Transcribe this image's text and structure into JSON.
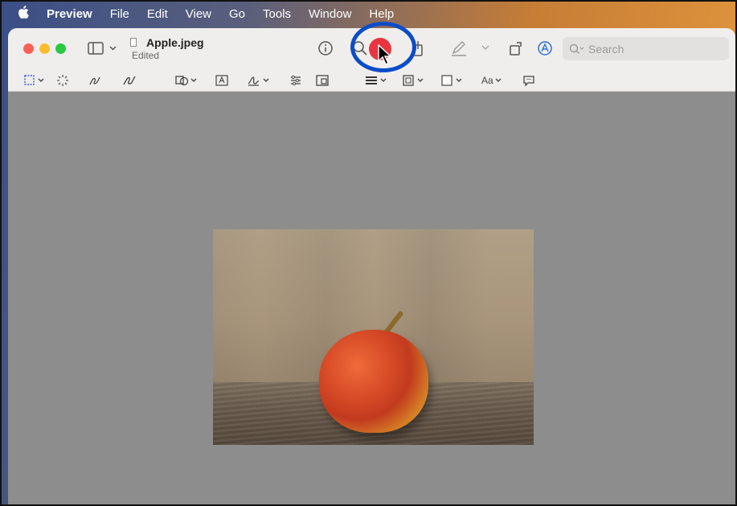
{
  "menubar": {
    "app_name": "Preview",
    "items": [
      "File",
      "Edit",
      "View",
      "Go",
      "Tools",
      "Window",
      "Help"
    ]
  },
  "document": {
    "filename": "Apple.jpeg",
    "status": "Edited"
  },
  "search": {
    "placeholder": "Search"
  },
  "toolbar": {
    "text_style_label": "Aa"
  },
  "colors": {
    "highlight_ring": "#0b4cc7",
    "record_button": "#e8353f"
  },
  "icons": {
    "apple_menu": "apple-logo-icon",
    "sidebar": "sidebar-toggle-icon",
    "info": "info-icon",
    "zoom": "zoom-icon",
    "share": "share-icon",
    "highlight": "highlight-pen-icon",
    "rotate": "rotate-icon",
    "markup": "markup-icon",
    "search": "search-icon"
  }
}
